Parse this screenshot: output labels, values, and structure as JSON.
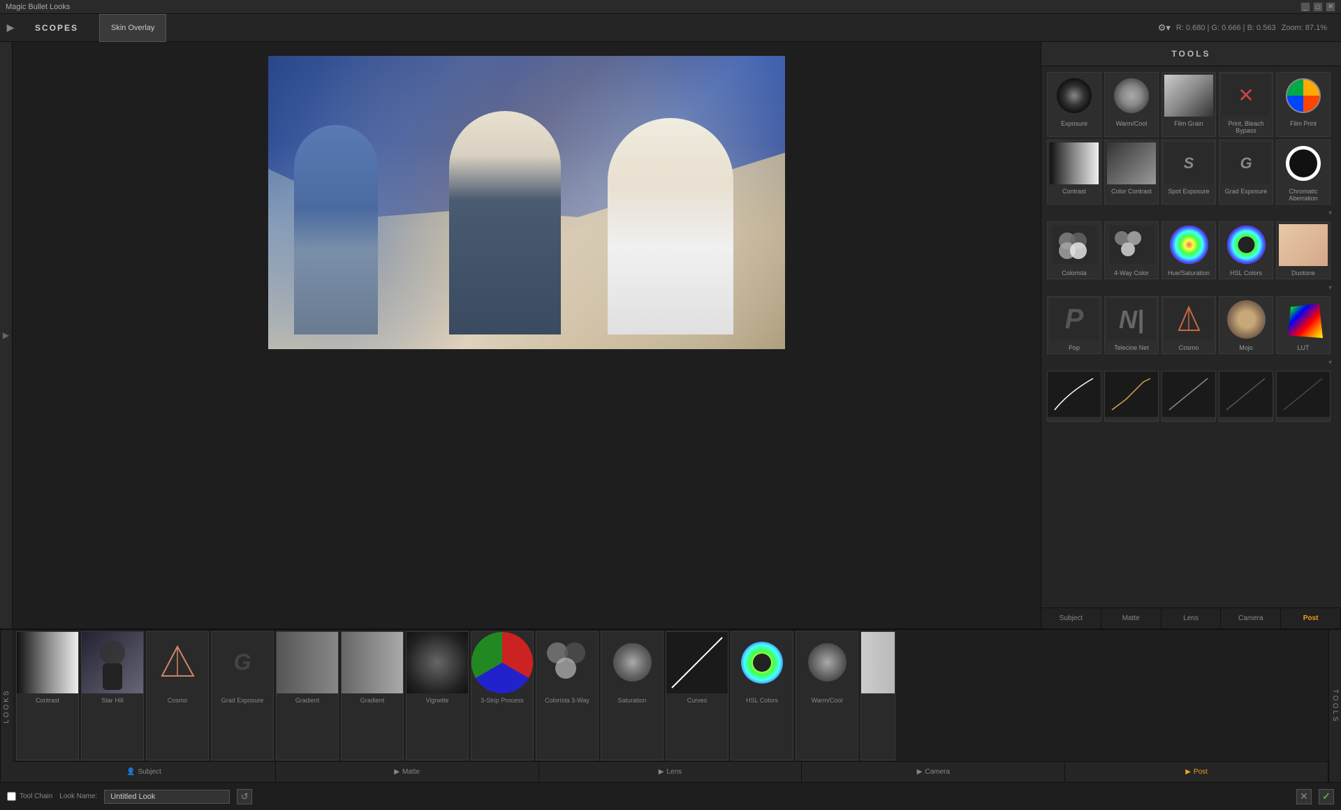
{
  "titlebar": {
    "title": "Magic Bullet Looks",
    "buttons": [
      "_",
      "□",
      "✕"
    ]
  },
  "topbar": {
    "nav_arrow": "▶",
    "scopes_label": "SCOPES",
    "skin_overlay_label": "Skin Overlay",
    "color_info": "R: 0.680 | G: 0.666 | B: 0.563",
    "zoom_label": "Zoom: 87.1%",
    "settings_icon": "⚙"
  },
  "tools": {
    "header": "TOOLS",
    "items": [
      {
        "id": "exposure",
        "label": "Exposure",
        "type": "exposure"
      },
      {
        "id": "warm-cool",
        "label": "Warm/Cool",
        "type": "warmcool"
      },
      {
        "id": "film-grain",
        "label": "Film Grain",
        "type": "filmgrain"
      },
      {
        "id": "print-bleach-bypass",
        "label": "Print, Bleach Bypass",
        "type": "printbleach"
      },
      {
        "id": "film-print",
        "label": "Film Print",
        "type": "filmprint"
      },
      {
        "id": "contrast",
        "label": "Contrast",
        "type": "contrast"
      },
      {
        "id": "color-contrast",
        "label": "Color Contrast",
        "type": "colorcontrast"
      },
      {
        "id": "spot-exposure",
        "label": "Spot Exposure",
        "type": "spotexposure"
      },
      {
        "id": "grad-exposure",
        "label": "Grad Exposure",
        "type": "gradexposure"
      },
      {
        "id": "chromatic-aberration",
        "label": "Chromatic Aberration",
        "type": "chromatic"
      },
      {
        "id": "colorista",
        "label": "Colorista",
        "type": "colorista"
      },
      {
        "id": "4way-color",
        "label": "4-Way Color",
        "type": "4waycolor"
      },
      {
        "id": "hue-saturation",
        "label": "Hue/Saturation",
        "type": "huesaturation"
      },
      {
        "id": "hsl-colors",
        "label": "HSL Colors",
        "type": "hslcolors"
      },
      {
        "id": "duotone",
        "label": "Duotone",
        "type": "duotone"
      },
      {
        "id": "pop",
        "label": "Pop",
        "type": "pop"
      },
      {
        "id": "telecine-net",
        "label": "Telecine Net",
        "type": "telecinenet"
      },
      {
        "id": "cosmo",
        "label": "Cosmo",
        "type": "cosmo"
      },
      {
        "id": "mojo",
        "label": "Mojo",
        "type": "mojo"
      },
      {
        "id": "lut",
        "label": "LUT",
        "type": "lut"
      }
    ],
    "curve_items": [
      {
        "id": "curve-s",
        "label": "",
        "type": "curve-s"
      },
      {
        "id": "curve-m",
        "label": "",
        "type": "curve-m"
      },
      {
        "id": "curve-l",
        "label": "",
        "type": "curve-l"
      },
      {
        "id": "curve-c",
        "label": "",
        "type": "curve-c"
      },
      {
        "id": "curve-e",
        "label": "",
        "type": "curve-e"
      }
    ],
    "tabs": [
      {
        "id": "subject",
        "label": "Subject"
      },
      {
        "id": "matte",
        "label": "Matte"
      },
      {
        "id": "lens",
        "label": "Lens"
      },
      {
        "id": "camera",
        "label": "Camera"
      },
      {
        "id": "post",
        "label": "Post",
        "active": true
      }
    ]
  },
  "looks_strip": {
    "items": [
      {
        "id": "contrast",
        "label": "Contrast",
        "type": "contrast",
        "has_close": false
      },
      {
        "id": "star-hill",
        "label": "Star Hill",
        "type": "starhill",
        "has_close": true
      },
      {
        "id": "cosmo",
        "label": "Cosmo",
        "type": "cosmo",
        "has_close": true
      },
      {
        "id": "grad-exposure",
        "label": "Grad Exposure",
        "type": "grad",
        "has_close": true
      },
      {
        "id": "gradient",
        "label": "Gradient",
        "type": "gradient",
        "has_close": true
      },
      {
        "id": "gradient2",
        "label": "Gradient",
        "type": "gradient2",
        "has_close": true
      },
      {
        "id": "vignette",
        "label": "Vignette",
        "type": "vignette",
        "has_close": true
      },
      {
        "id": "3strip-process",
        "label": "3-Strip Process",
        "type": "3strip",
        "has_close": false
      },
      {
        "id": "colorista-3way",
        "label": "Colorista 3-Way",
        "type": "colorista3way",
        "has_close": false
      },
      {
        "id": "saturation",
        "label": "Saturation",
        "type": "saturation",
        "has_close": false
      },
      {
        "id": "curves",
        "label": "Curves",
        "type": "curves",
        "has_close": false
      },
      {
        "id": "hsl-colors",
        "label": "HSL Colors",
        "type": "hslcolors",
        "has_close": false
      },
      {
        "id": "warm-cool",
        "label": "Warm/Cool",
        "type": "warmcool",
        "has_close": false
      }
    ]
  },
  "categories": [
    {
      "id": "subject",
      "label": "Subject",
      "icon": "👤"
    },
    {
      "id": "matte",
      "label": "Matte",
      "icon": "▶"
    },
    {
      "id": "lens",
      "label": "Lens",
      "icon": "▶"
    },
    {
      "id": "camera",
      "label": "Camera",
      "icon": "▶"
    },
    {
      "id": "post",
      "label": "Post",
      "icon": "▶",
      "active": true
    }
  ],
  "bottombar": {
    "toolchain_label": "Tool Chain",
    "look_name_label": "Look Name:",
    "look_name_value": "Untitled Look",
    "reset_icon": "↺",
    "cancel_icon": "✕",
    "confirm_icon": "✓"
  }
}
